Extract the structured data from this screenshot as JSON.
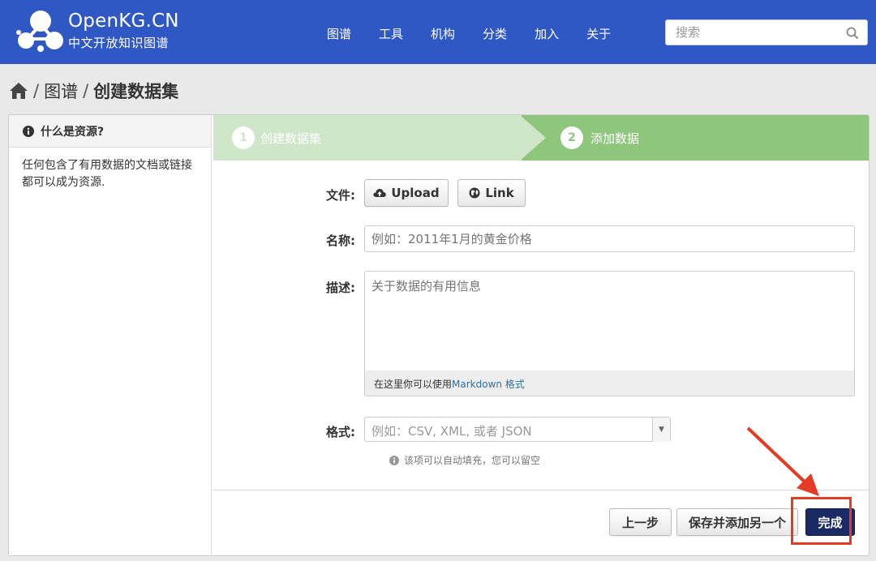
{
  "header": {
    "brand_name": "OpenKG.CN",
    "brand_sub": "中文开放知识图谱",
    "nav": [
      "图谱",
      "工具",
      "机构",
      "分类",
      "加入",
      "关于"
    ],
    "search_placeholder": "搜索",
    "bg_color": "#2f58c4"
  },
  "breadcrumb": {
    "home_icon": "home-icon",
    "sep": "/",
    "items": [
      "图谱",
      "创建数据集"
    ]
  },
  "sidebar": {
    "title": "什么是资源?",
    "body": "任何包含了有用数据的文档或链接都可以成为资源."
  },
  "steps": [
    {
      "number": "1",
      "label": "创建数据集"
    },
    {
      "number": "2",
      "label": "添加数据"
    }
  ],
  "form": {
    "file_label": "文件:",
    "upload_label": "Upload",
    "link_label": "Link",
    "name_label": "名称:",
    "name_placeholder": "例如：2011年1月的黄金价格",
    "desc_label": "描述:",
    "desc_placeholder": "关于数据的有用信息",
    "markdown_hint_prefix": "在这里你可以使用",
    "markdown_hint_link": "Markdown 格式",
    "format_label": "格式:",
    "format_placeholder": "例如：CSV, XML, 或者 JSON",
    "autofill_hint": "该项可以自动填充，您可以留空"
  },
  "actions": {
    "prev": "上一步",
    "save_add": "保存并添加另一个",
    "finish": "完成"
  },
  "colors": {
    "step_done": "#cfe6c8",
    "step_active": "#8ec67c",
    "primary": "#1a2a64",
    "highlight": "#e53a24"
  }
}
